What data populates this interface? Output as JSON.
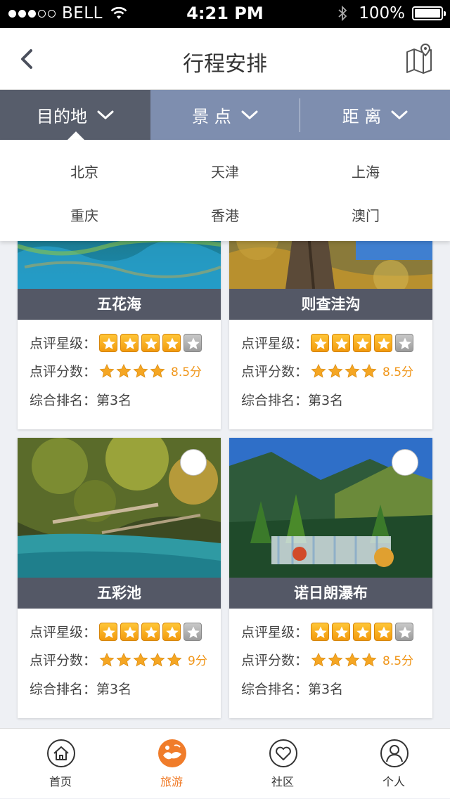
{
  "status_bar": {
    "carrier": "BELL",
    "time": "4:21 PM",
    "battery": "100%"
  },
  "header": {
    "title": "行程安排"
  },
  "filters": [
    {
      "label": "目的地",
      "active": true
    },
    {
      "label": "景 点",
      "active": false
    },
    {
      "label": "距 离",
      "active": false
    }
  ],
  "dropdown": {
    "cities": [
      "北京",
      "天津",
      "上海",
      "重庆",
      "香港",
      "澳门"
    ]
  },
  "labels": {
    "stars": "点评星级：",
    "score": "点评分数：",
    "rank": "综合排名："
  },
  "spots": [
    {
      "name": "五花海",
      "stars": 4,
      "score_stars": 4,
      "score": "8.5分",
      "rank": "第3名"
    },
    {
      "name": "则查洼沟",
      "stars": 4,
      "score_stars": 4,
      "score": "8.5分",
      "rank": "第3名"
    },
    {
      "name": "五彩池",
      "stars": 4,
      "score_stars": 5,
      "score": "9分",
      "rank": "第3名"
    },
    {
      "name": "诺日朗瀑布",
      "stars": 4,
      "score_stars": 4,
      "score": "8.5分",
      "rank": "第3名"
    }
  ],
  "tabbar": [
    {
      "label": "首页",
      "icon": "home-icon",
      "active": false
    },
    {
      "label": "旅游",
      "icon": "travel-icon",
      "active": true
    },
    {
      "label": "社区",
      "icon": "heart-icon",
      "active": false
    },
    {
      "label": "个人",
      "icon": "person-icon",
      "active": false
    }
  ],
  "colors": {
    "accent": "#f07c2a",
    "filter_bar": "#7e8eaf",
    "filter_active": "#575d6b",
    "caption_bg": "#545866",
    "star_gold": "#f5a623"
  }
}
